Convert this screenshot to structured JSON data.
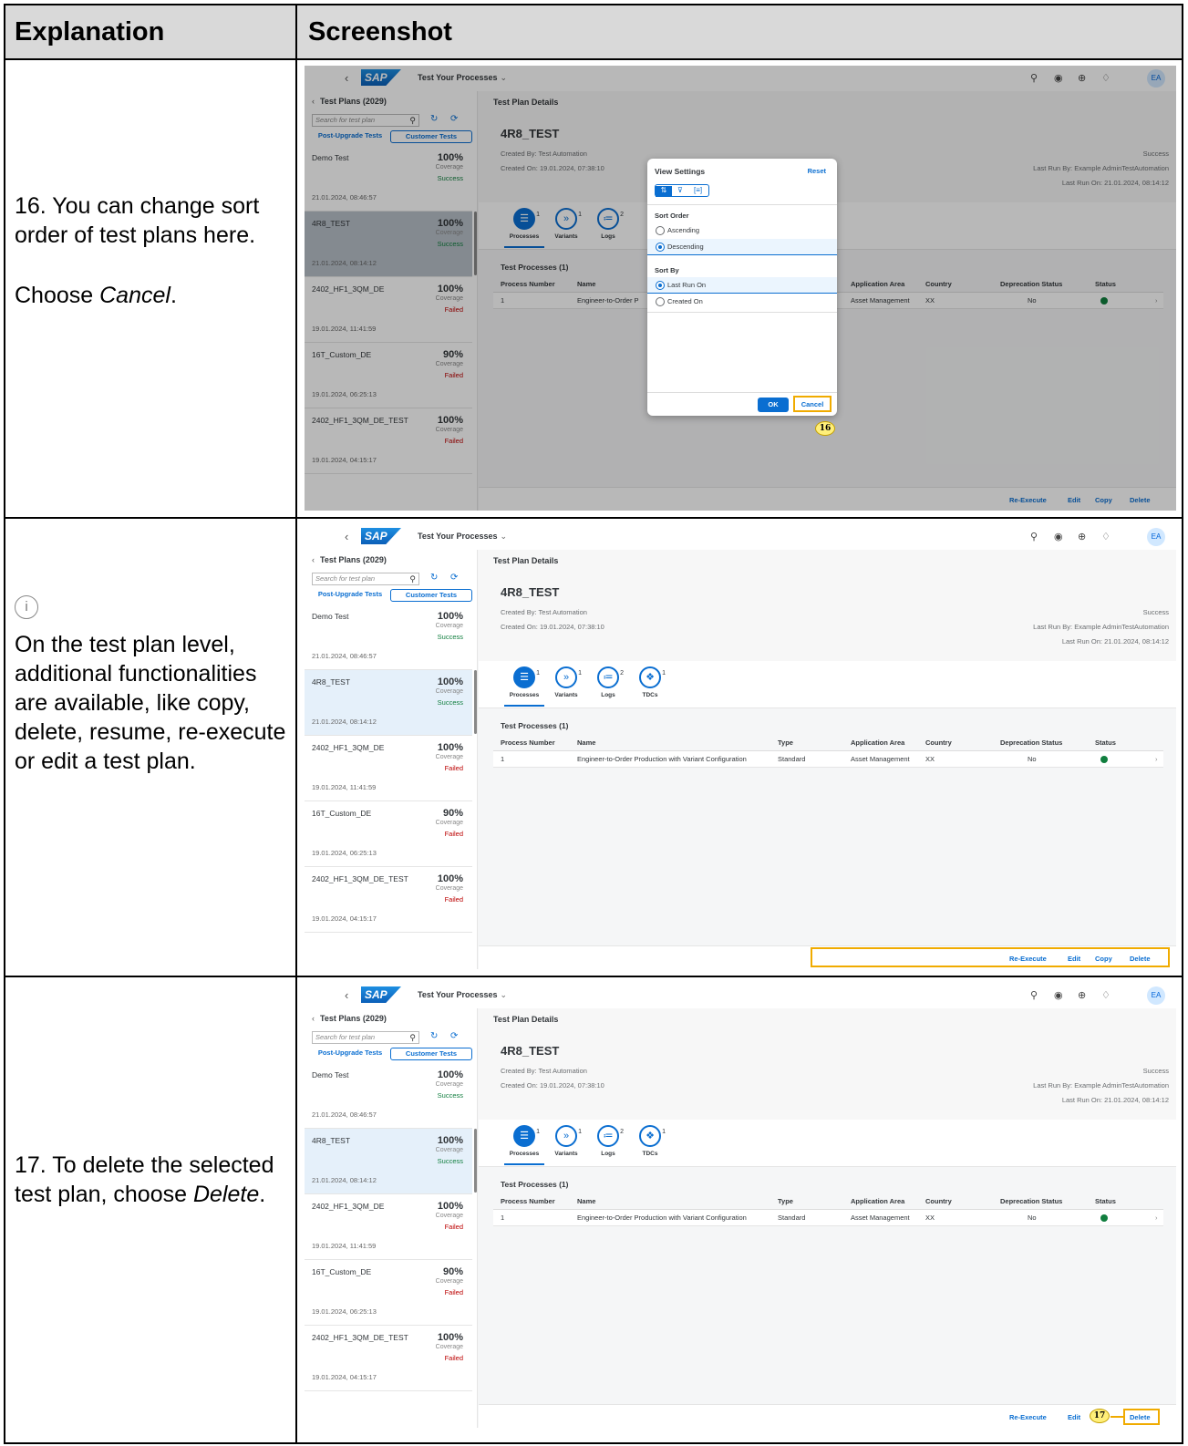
{
  "table": {
    "header_explanation": "Explanation",
    "header_screenshot": "Screenshot"
  },
  "rows": [
    {
      "explanation": [
        "16. You can change sort order of test plans here.",
        "Choose Cancel."
      ],
      "callout": "16"
    },
    {
      "info_icon": "info-icon",
      "explanation": [
        "On the test plan level, additional functionalities are available, like copy, delete, resume, re-execute or edit a test plan."
      ]
    },
    {
      "explanation": [
        "17. To delete the selected test plan, choose Delete."
      ],
      "callout": "17"
    }
  ],
  "sap": {
    "app_title": "Test Your Processes",
    "logo": "SAP",
    "avatar": "EA",
    "master_title": "Test Plans (2029)",
    "search_placeholder": "Search for test plan",
    "tab_post_upgrade": "Post-Upgrade Tests",
    "tab_customer": "Customer Tests",
    "plans": [
      {
        "name": "Demo Test",
        "pct": "100%",
        "coverage": "Coverage",
        "status": "Success",
        "date": "21.01.2024, 08:46:57"
      },
      {
        "name": "4R8_TEST",
        "pct": "100%",
        "coverage": "Coverage",
        "status": "Success",
        "date": "21.01.2024, 08:14:12"
      },
      {
        "name": "2402_HF1_3QM_DE",
        "pct": "100%",
        "coverage": "Coverage",
        "status": "Failed",
        "date": "19.01.2024, 11:41:59"
      },
      {
        "name": "16T_Custom_DE",
        "pct": "90%",
        "coverage": "Coverage",
        "status": "Failed",
        "date": "19.01.2024, 06:25:13"
      },
      {
        "name": "2402_HF1_3QM_DE_TEST",
        "pct": "100%",
        "coverage": "Coverage",
        "status": "Failed",
        "date": "19.01.2024, 04:15:17"
      }
    ],
    "detail_title": "Test Plan Details",
    "plan_name": "4R8_TEST",
    "created_by": "Created By: Test Automation",
    "created_on": "Created On: 19.01.2024, 07:38:10",
    "status": "Success",
    "last_run_by": "Last Run By: Example AdminTestAutomation",
    "last_run_on": "Last Run On: 21.01.2024, 08:14:12",
    "tabs": [
      {
        "label": "Processes",
        "count": "1"
      },
      {
        "label": "Variants",
        "count": "1"
      },
      {
        "label": "Logs",
        "count": "2"
      },
      {
        "label": "TDCs",
        "count": "1"
      }
    ],
    "section_title": "Test Processes (1)",
    "columns": [
      "Process Number",
      "Name",
      "Type",
      "Application Area",
      "Country",
      "Deprecation Status",
      "Status"
    ],
    "process_row": {
      "number": "1",
      "name": "Engineer-to-Order Production with Variant Configuration",
      "name_truncated": "Engineer-to-Order P",
      "type": "Standard",
      "area": "Asset Management",
      "country": "XX",
      "deprecation": "No",
      "status_icon": "success-icon",
      "chevron": "›"
    },
    "actions": {
      "reexecute": "Re-Execute",
      "edit": "Edit",
      "copy": "Copy",
      "delete": "Delete"
    },
    "dialog": {
      "title": "View Settings",
      "reset": "Reset",
      "sort_order": "Sort Order",
      "ascending": "Ascending",
      "descending": "Descending",
      "sort_by": "Sort By",
      "last_run_on": "Last Run On",
      "created_on": "Created On",
      "ok": "OK",
      "cancel": "Cancel"
    }
  }
}
